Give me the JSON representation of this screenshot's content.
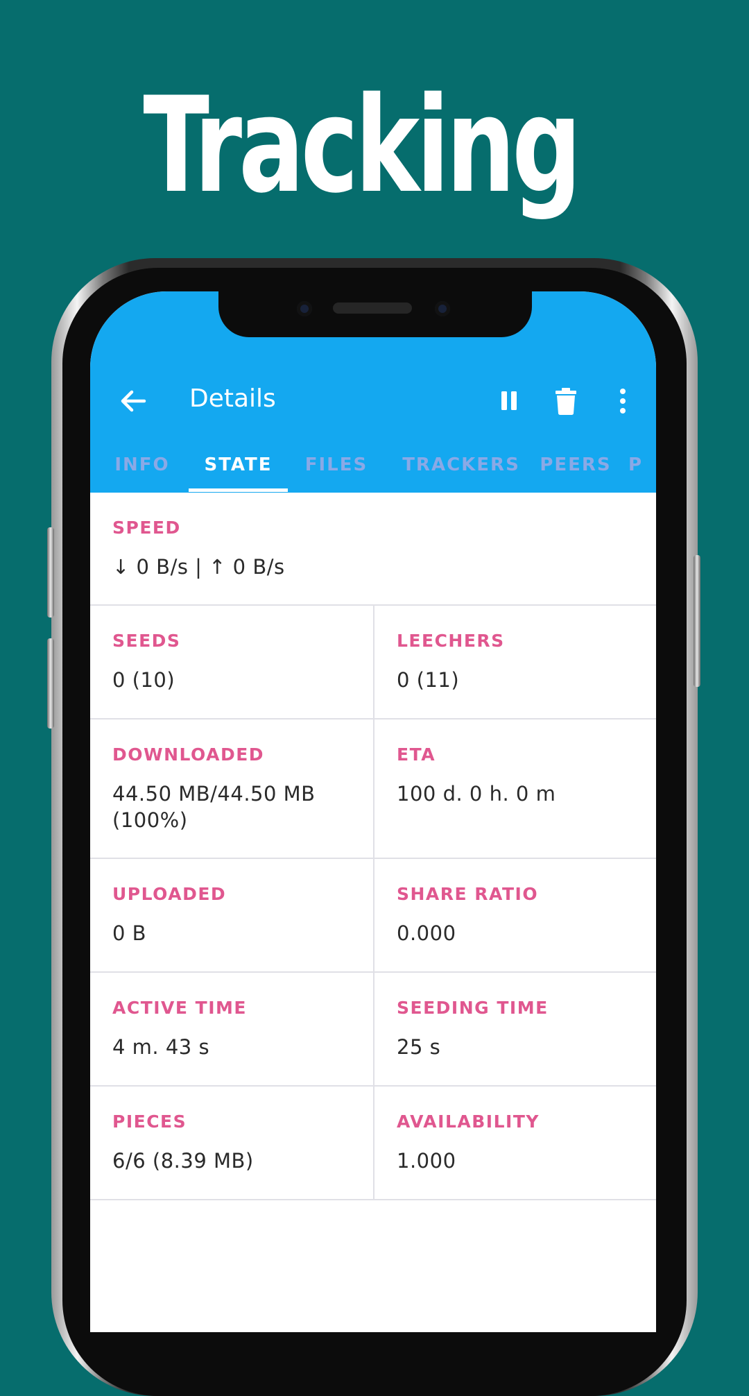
{
  "promo": {
    "title": "Tracking"
  },
  "colors": {
    "background": "#066d6d",
    "appbar": "#14a8f0",
    "label": "#e0578f"
  },
  "toolbar": {
    "back_icon": "arrow-left-icon",
    "title": "Details",
    "actions": [
      "pause-icon",
      "delete-icon",
      "more-vert-icon"
    ]
  },
  "tabs": [
    {
      "label": "INFO",
      "active": false
    },
    {
      "label": "STATE",
      "active": true
    },
    {
      "label": "FILES",
      "active": false
    },
    {
      "label": "TRACKERS",
      "active": false
    },
    {
      "label": "PEERS",
      "active": false
    },
    {
      "label": "P",
      "active": false
    }
  ],
  "state": {
    "speed": {
      "label": "SPEED",
      "value": "↓ 0 B/s | ↑ 0 B/s"
    },
    "seeds": {
      "label": "SEEDS",
      "value": "0 (10)"
    },
    "leechers": {
      "label": "LEECHERS",
      "value": "0 (11)"
    },
    "downloaded": {
      "label": "DOWNLOADED",
      "value": "44.50 MB/44.50 MB (100%)"
    },
    "eta": {
      "label": "ETA",
      "value": "100 d. 0 h. 0 m"
    },
    "uploaded": {
      "label": "UPLOADED",
      "value": "0 B"
    },
    "share_ratio": {
      "label": "SHARE RATIO",
      "value": "0.000"
    },
    "active_time": {
      "label": "ACTIVE TIME",
      "value": "4 m. 43 s"
    },
    "seeding_time": {
      "label": "SEEDING TIME",
      "value": "25 s"
    },
    "pieces": {
      "label": "PIECES",
      "value": "6/6 (8.39 MB)"
    },
    "availability": {
      "label": "AVAILABILITY",
      "value": "1.000"
    }
  }
}
